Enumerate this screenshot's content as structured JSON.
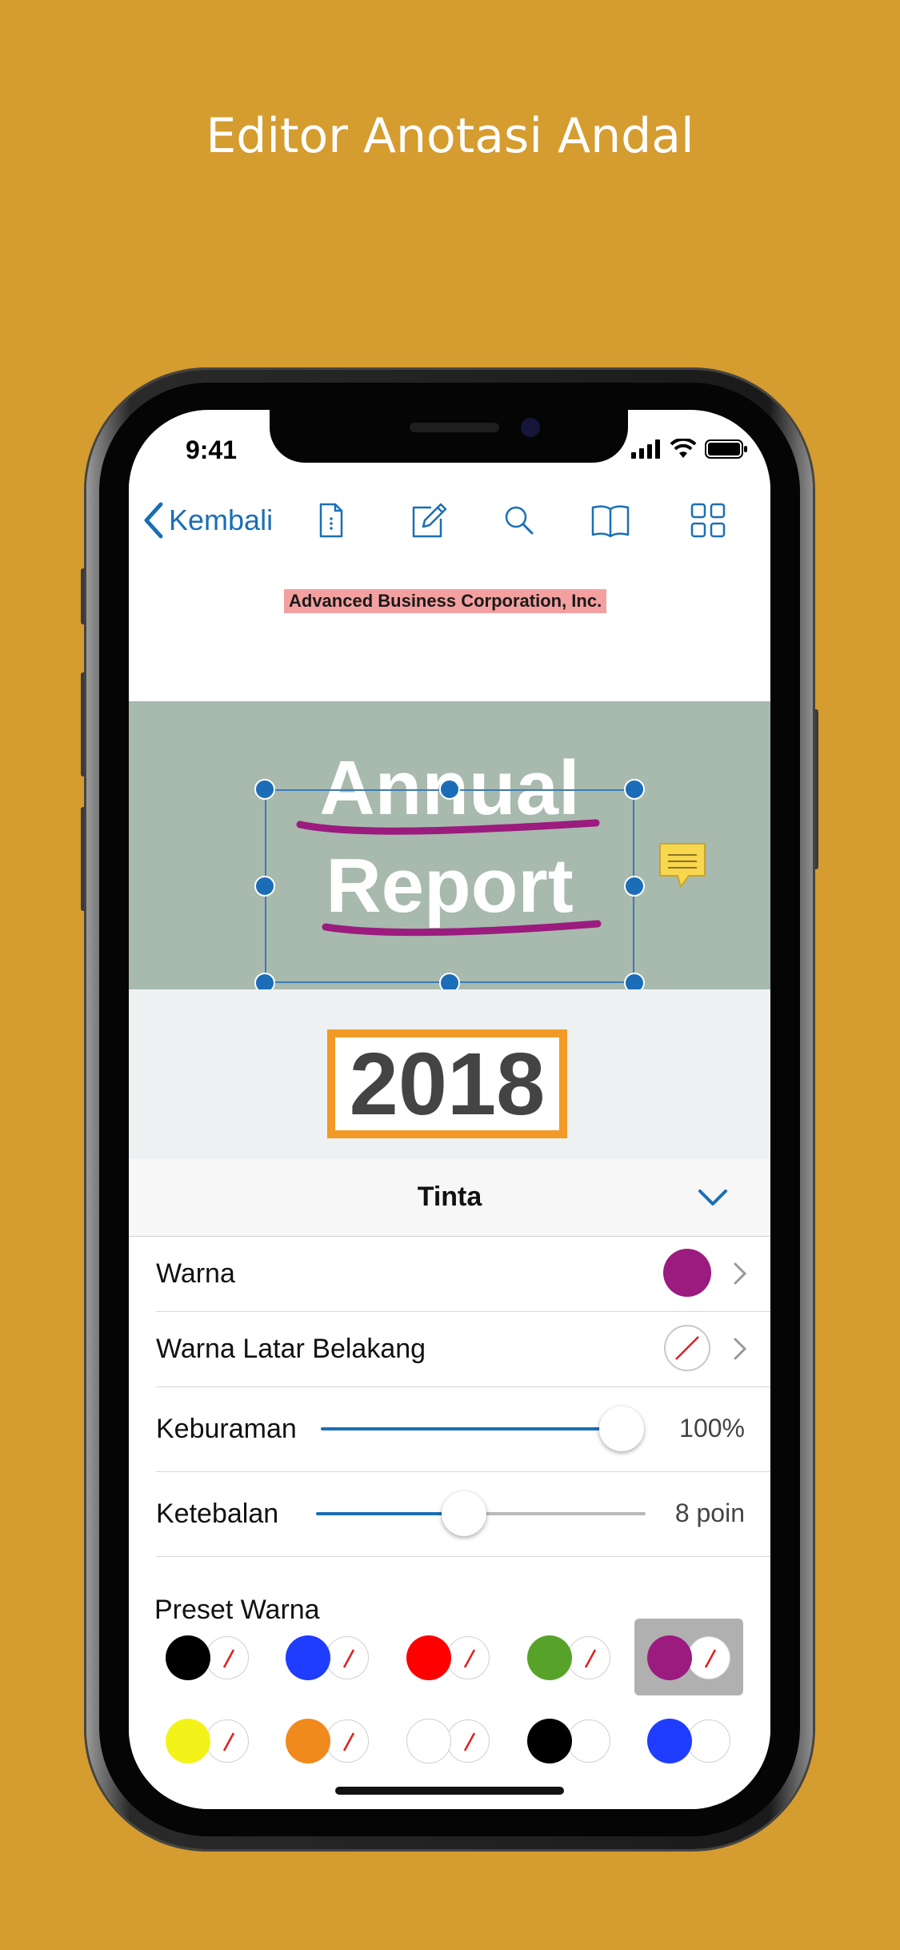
{
  "headline": "Editor Anotasi Andal",
  "status_bar": {
    "time": "9:41"
  },
  "nav": {
    "back_label": "Kembali",
    "icons": [
      "document-outline-icon",
      "edit-pencil-icon",
      "search-icon",
      "book-icon",
      "grid-icon"
    ]
  },
  "document": {
    "company": "Advanced Business Corporation, Inc.",
    "title_line1": "Annual",
    "title_line2": "Report",
    "year": "2018"
  },
  "ink_panel": {
    "title": "Tinta",
    "color_label": "Warna",
    "color_value": "#9b1b7e",
    "background_label": "Warna Latar Belakang",
    "opacity_label": "Keburaman",
    "opacity_value": "100%",
    "opacity_level": 1.0,
    "thickness_label": "Ketebalan",
    "thickness_value": "8 poin",
    "thickness_level": 0.45,
    "presets_label": "Preset Warna",
    "presets": [
      {
        "color": "#000000",
        "bg": "none"
      },
      {
        "color": "#1f3dff",
        "bg": "none"
      },
      {
        "color": "#ff0000",
        "bg": "none"
      },
      {
        "color": "#57a32a",
        "bg": "none"
      },
      {
        "color": "#9b1b7e",
        "bg": "none",
        "selected": true
      },
      {
        "color": "#f3f31a",
        "bg": "none"
      },
      {
        "color": "#f08a1c",
        "bg": "none"
      },
      {
        "color": "#ffffff",
        "bg": "none"
      },
      {
        "color": "#000000",
        "bg": "#ffffff"
      },
      {
        "color": "#1f3dff",
        "bg": "#ffffff"
      }
    ]
  },
  "colors": {
    "background": "#d59c2f",
    "accent": "#1a6fb5",
    "ink": "#9b1b7e",
    "highlight": "#f4a0a0",
    "year_border": "#f29a25",
    "banner": "#a8b9ae",
    "note": "#f8d64e"
  }
}
